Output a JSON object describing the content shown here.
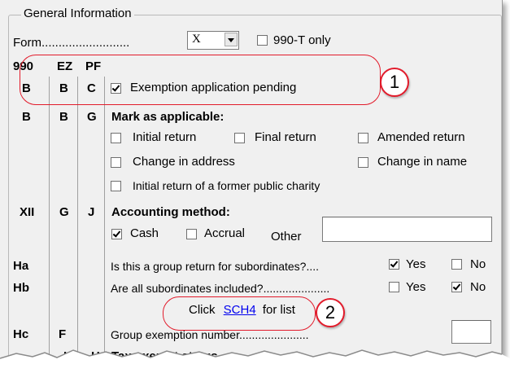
{
  "group": {
    "title": "General Information"
  },
  "form": {
    "label": "Form",
    "dots": "..........................",
    "select_value": "X",
    "only_990t_label": "990-T only"
  },
  "columns": {
    "c990": "990",
    "cEZ": "EZ",
    "cPF": "PF"
  },
  "rows": {
    "exemption": {
      "c1": "B",
      "c2": "B",
      "c3": "C",
      "label": "Exemption application pending",
      "checked": true
    },
    "mark": {
      "c1": "B",
      "c2": "B",
      "c3": "G",
      "heading": "Mark as applicable:"
    },
    "checkboxes": {
      "initial_return": "Initial return",
      "final_return": "Final return",
      "amended_return": "Amended return",
      "change_address": "Change in address",
      "change_name": "Change in name",
      "initial_former": "Initial return of a former public charity"
    },
    "accounting": {
      "c1": "XII",
      "c2": "G",
      "c3": "J",
      "heading": "Accounting method:",
      "cash": "Cash",
      "accrual": "Accrual",
      "other": "Other"
    },
    "group_return": {
      "c1": "Ha",
      "question": "Is this a group return for subordinates?....",
      "yes": "Yes",
      "no": "No"
    },
    "subordinates": {
      "c1": "Hb",
      "question": "Are all subordinates included?.....................",
      "yes": "Yes",
      "no": "No"
    },
    "click_list": {
      "prefix": "Click",
      "link": "SCH4",
      "suffix": "for list"
    },
    "group_exemption": {
      "c1": "Hc",
      "c2": "F",
      "label": "Group exemption number......................"
    },
    "partial": {
      "c2": "I",
      "c3": "H",
      "label": "Tax-exempt status"
    }
  },
  "callouts": {
    "one": "1",
    "two": "2"
  },
  "colors": {
    "callout_red": "#e21b2b",
    "link_blue": "#0000ee"
  }
}
